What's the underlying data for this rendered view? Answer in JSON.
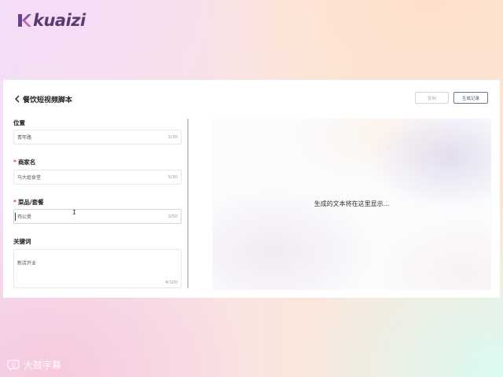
{
  "brand": {
    "logo_text": "kuaizi",
    "logo_color": "#5b3a74"
  },
  "header": {
    "title": "餐饮短视频脚本",
    "copy_label": "复制",
    "history_label": "生成记录"
  },
  "form": {
    "fields": [
      {
        "label": "位置",
        "required": false,
        "value": "青年路",
        "count": "3/30"
      },
      {
        "label": "商家名",
        "required": true,
        "value": "马大姐食堂",
        "count": "5/30"
      },
      {
        "label": "菜品/套餐",
        "required": true,
        "value": "鸡公煲",
        "count": "3/50"
      }
    ],
    "keywords": {
      "label": "关键词",
      "value": "新店开业",
      "count": "4/100"
    },
    "required_mark": "*"
  },
  "output": {
    "placeholder": "生成的文本将在这里显示..."
  },
  "watermark": {
    "text": "大鼓字幕"
  },
  "colors": {
    "required": "#e5484d",
    "history_border": "#6a7a92",
    "copy_border": "#cfd6de"
  }
}
